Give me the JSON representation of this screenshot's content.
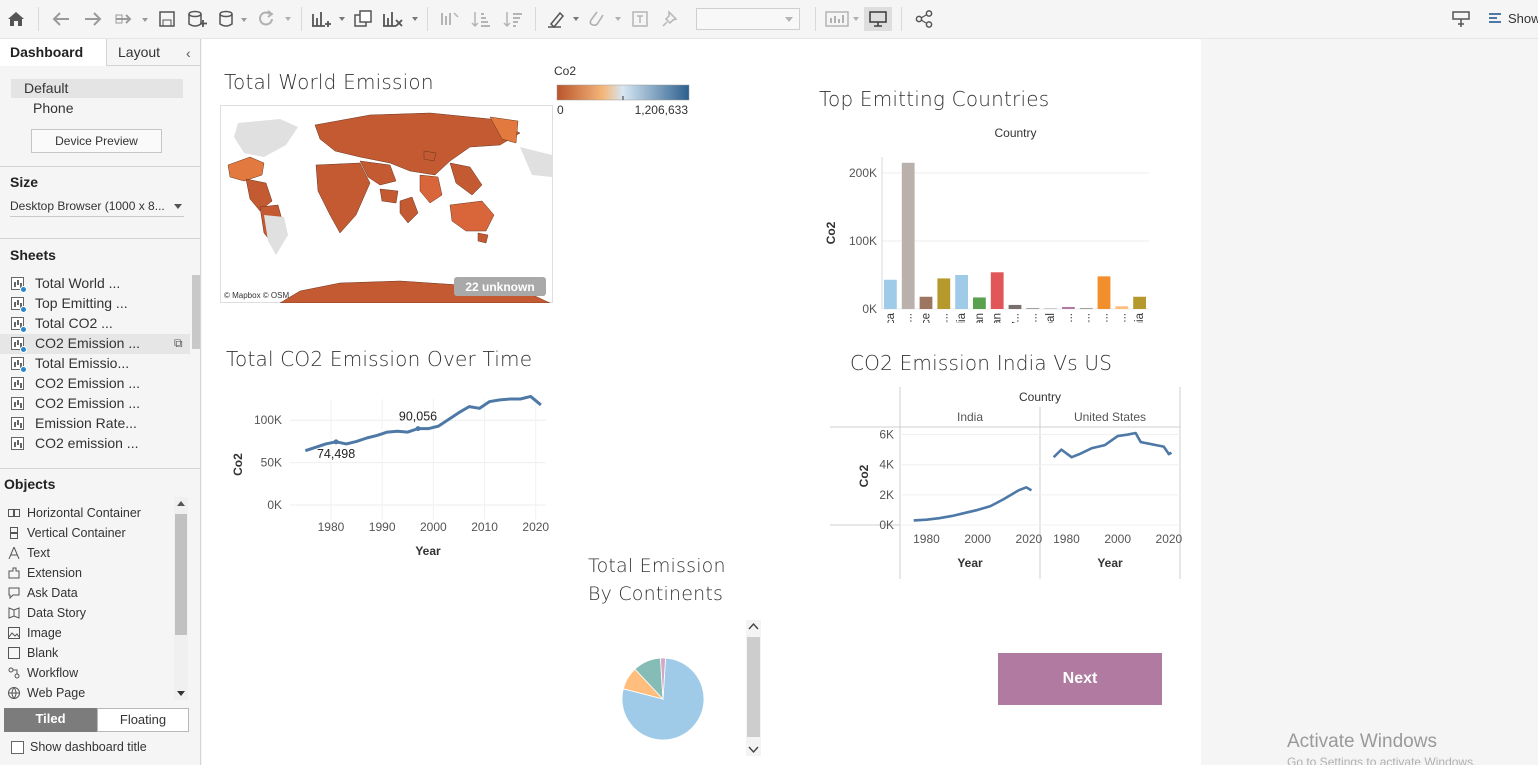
{
  "toolbar": {
    "icons": [
      "home-icon",
      "undo-icon",
      "redo-icon",
      "pause-updates-icon",
      "save-icon",
      "new-datasource-icon",
      "datasource-icon",
      "refresh-icon",
      "new-worksheet-icon",
      "duplicate-icon",
      "clear-icon",
      "swap-icon",
      "sort-ascending-icon",
      "sort-descending-icon",
      "highlight-icon",
      "group-icon",
      "labels-icon",
      "pin-icon",
      "show-me-icon",
      "presentation-icon",
      "share-icon",
      "show-hide-cards-icon",
      "show-me-panel-icon"
    ],
    "show_label": "Show"
  },
  "left_panel": {
    "tabs": {
      "dashboard": "Dashboard",
      "layout": "Layout"
    },
    "devices": {
      "default": "Default",
      "phone": "Phone",
      "preview_button": "Device Preview"
    },
    "size": {
      "title": "Size",
      "value": "Desktop Browser (1000 x 8..."
    },
    "sheets": {
      "title": "Sheets",
      "items": [
        {
          "label": "Total World ...",
          "used": true
        },
        {
          "label": "Top Emitting ...",
          "used": true
        },
        {
          "label": "Total CO2 ...",
          "used": true
        },
        {
          "label": "CO2 Emission ...",
          "used": true,
          "selected": true
        },
        {
          "label": "Total Emissio...",
          "used": true
        },
        {
          "label": "CO2 Emission ...",
          "used": false
        },
        {
          "label": "CO2 Emission ...",
          "used": false
        },
        {
          "label": "Emission Rate...",
          "used": false
        },
        {
          "label": "CO2 emission ...",
          "used": false
        }
      ]
    },
    "objects": {
      "title": "Objects",
      "items": [
        {
          "label": "Horizontal Container",
          "icon": "horizontal-container-icon"
        },
        {
          "label": "Vertical Container",
          "icon": "vertical-container-icon"
        },
        {
          "label": "Text",
          "icon": "text-icon"
        },
        {
          "label": "Extension",
          "icon": "extension-icon"
        },
        {
          "label": "Ask Data",
          "icon": "ask-data-icon"
        },
        {
          "label": "Data Story",
          "icon": "data-story-icon"
        },
        {
          "label": "Image",
          "icon": "image-icon"
        },
        {
          "label": "Blank",
          "icon": "blank-icon"
        },
        {
          "label": "Workflow",
          "icon": "workflow-icon"
        },
        {
          "label": "Web Page",
          "icon": "web-page-icon"
        }
      ]
    },
    "tiled": "Tiled",
    "floating": "Floating",
    "show_title": "Show dashboard title"
  },
  "dashboard": {
    "map": {
      "title": "Total World Emission",
      "legend_title": "Co2",
      "legend_min": "0",
      "legend_max": "1,206,633",
      "unknown_badge": "22 unknown",
      "attribution": "© Mapbox © OSM"
    },
    "top_countries": {
      "title": "Top Emitting Countries"
    },
    "over_time": {
      "title": "Total CO2 Emission Over Time"
    },
    "india_us": {
      "title": "CO2 Emission India Vs US"
    },
    "continents": {
      "title_line1": "Total Emission",
      "title_line2": "By Continents"
    },
    "next_button": "Next"
  },
  "windows_watermark": {
    "line1": "Activate Windows",
    "line2": "Go to Settings to activate Windows."
  },
  "colors": {
    "line": "#4e79a7",
    "next": "#b07aa1",
    "map_fill": "#c35a32"
  },
  "chart_data": [
    {
      "type": "bar",
      "title": "Top Emitting Countries",
      "header": "Country",
      "ylabel": "Co2",
      "ylim": [
        0,
        200000
      ],
      "yticks": [
        "0K",
        "100K",
        "200K"
      ],
      "categories": [
        "Africa",
        "Asia (e...",
        "France",
        "Germa...",
        "India",
        "Iran",
        "Japan",
        "Malay...",
        "Myan...",
        "Nepal",
        "New Z...",
        "Nicara...",
        "North ...",
        "North ...",
        "Oceania"
      ],
      "values": [
        43000,
        215000,
        18000,
        45000,
        50000,
        17000,
        54000,
        6000,
        1000,
        500,
        3000,
        1000,
        48000,
        4000,
        18000
      ],
      "colors": [
        "#a0cbe8",
        "#bab0ac",
        "#9d7660",
        "#b6992d",
        "#a0cbe8",
        "#59a14f",
        "#e15759",
        "#79706e",
        "#79706e",
        "#79706e",
        "#b07aa1",
        "#79706e",
        "#f28e2b",
        "#ffbe7d",
        "#b6992d"
      ]
    },
    {
      "type": "line",
      "title": "Total CO2 Emission Over Time",
      "xlabel": "Year",
      "ylabel": "Co2",
      "xlim": [
        1972,
        2022
      ],
      "ylim": [
        0,
        125000
      ],
      "xticks": [
        1980,
        1990,
        2000,
        2010,
        2020
      ],
      "yticks": [
        "0K",
        "50K",
        "100K"
      ],
      "x": [
        1975,
        1977,
        1979,
        1981,
        1983,
        1985,
        1987,
        1989,
        1991,
        1993,
        1995,
        1997,
        1999,
        2001,
        2003,
        2005,
        2007,
        2009,
        2011,
        2013,
        2015,
        2017,
        2019,
        2021
      ],
      "y": [
        64000,
        68000,
        72000,
        74498,
        72000,
        75000,
        79000,
        82000,
        86000,
        87000,
        86000,
        90056,
        90000,
        93000,
        101000,
        109000,
        116000,
        114000,
        122000,
        124000,
        125000,
        125000,
        128000,
        118000
      ],
      "annotations": [
        {
          "x": 1981,
          "y": 74498,
          "label": "74,498"
        },
        {
          "x": 1997,
          "y": 90056,
          "label": "90,056"
        }
      ]
    },
    {
      "type": "line",
      "title": "CO2 Emission India Vs US",
      "header": "Country",
      "xlabel": "Year",
      "ylabel": "Co2",
      "ylim": [
        0,
        6500
      ],
      "yticks": [
        "0K",
        "2K",
        "4K",
        "6K"
      ],
      "xticks": [
        1980,
        2000,
        2020
      ],
      "series": [
        {
          "name": "India",
          "x": [
            1975,
            1980,
            1985,
            1990,
            1995,
            2000,
            2005,
            2010,
            2013,
            2016,
            2019,
            2021
          ],
          "y": [
            300,
            350,
            450,
            600,
            800,
            1000,
            1250,
            1700,
            2000,
            2300,
            2500,
            2300
          ]
        },
        {
          "name": "United States",
          "x": [
            1975,
            1978,
            1982,
            1985,
            1990,
            1995,
            2000,
            2004,
            2007,
            2009,
            2012,
            2015,
            2018,
            2020,
            2021
          ],
          "y": [
            4500,
            5000,
            4500,
            4700,
            5100,
            5300,
            5900,
            6000,
            6100,
            5500,
            5400,
            5300,
            5200,
            4700,
            4800
          ]
        }
      ]
    },
    {
      "type": "pie",
      "title": "Total Emission By Continents",
      "values": [
        78,
        9,
        11,
        2
      ],
      "colors": [
        "#a0cbe8",
        "#ffbe7d",
        "#86bcb6",
        "#d4a6c8"
      ]
    }
  ]
}
